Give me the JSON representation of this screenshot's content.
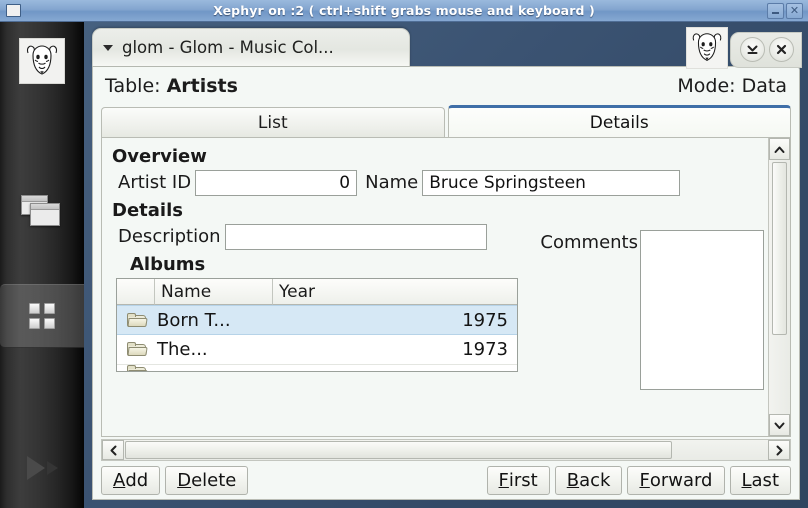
{
  "outer_window": {
    "title": "Xephyr on :2 ( ctrl+shift grabs mouse and keyboard )",
    "minimize_label": "−",
    "close_label": "✕",
    "titlebar_color": "#83a5cf"
  },
  "dock": {
    "items": [
      {
        "name": "gnu-logo",
        "label": "GNU"
      },
      {
        "name": "windows",
        "label": "Windows"
      },
      {
        "name": "workspaces",
        "label": "Workspaces",
        "selected": true
      },
      {
        "name": "play",
        "label": "Play"
      }
    ]
  },
  "inner_window": {
    "tab_title": "glom - Glom - Music Col...",
    "minimize_label": "Minimize",
    "close_label": "Close",
    "chrome_color": "#3b5372"
  },
  "header": {
    "table_prefix": "Table: ",
    "table_name": "Artists",
    "mode_prefix": "Mode: ",
    "mode_name": "Data"
  },
  "tabs": [
    {
      "label": "List",
      "active": false
    },
    {
      "label": "Details",
      "active": true
    }
  ],
  "form": {
    "overview_heading": "Overview",
    "artist_id_label": "Artist ID",
    "artist_id_value": "0",
    "name_label": "Name",
    "name_value": "Bruce Springsteen",
    "details_heading": "Details",
    "description_label": "Description",
    "description_value": "",
    "comments_label": "Comments",
    "comments_value": "",
    "albums_heading": "Albums"
  },
  "albums_table": {
    "columns": [
      "",
      "Name",
      "Year"
    ],
    "rows": [
      {
        "icon": "folder-icon",
        "name": "Born T...",
        "year": "1975",
        "selected": true
      },
      {
        "icon": "folder-icon",
        "name": "The...",
        "year": "1973",
        "selected": false
      },
      {
        "icon": "folder-icon",
        "name": "",
        "year": "",
        "selected": false,
        "clipped": true
      }
    ]
  },
  "scrollbars": {
    "vertical": {
      "up": "⌃",
      "down": "⌄",
      "thumb_position_pct": 0
    },
    "horizontal": {
      "left": "‹",
      "right": "›",
      "thumb_position_pct": 0
    }
  },
  "buttons": {
    "left": [
      {
        "mnemonic": "A",
        "rest": "dd",
        "name": "add-button"
      },
      {
        "mnemonic": "D",
        "rest": "elete",
        "name": "delete-button"
      }
    ],
    "right": [
      {
        "mnemonic": "F",
        "rest": "irst",
        "name": "first-button"
      },
      {
        "mnemonic": "B",
        "rest": "ack",
        "name": "back-button"
      },
      {
        "mnemonic": "F",
        "rest": "orward",
        "name": "forward-button"
      },
      {
        "mnemonic": "L",
        "rest": "ast",
        "name": "last-button"
      }
    ]
  },
  "colors": {
    "selection": "#d6e8f5",
    "content_bg": "#f4f8f5",
    "active_tab_accent": "#3f6fa8"
  }
}
